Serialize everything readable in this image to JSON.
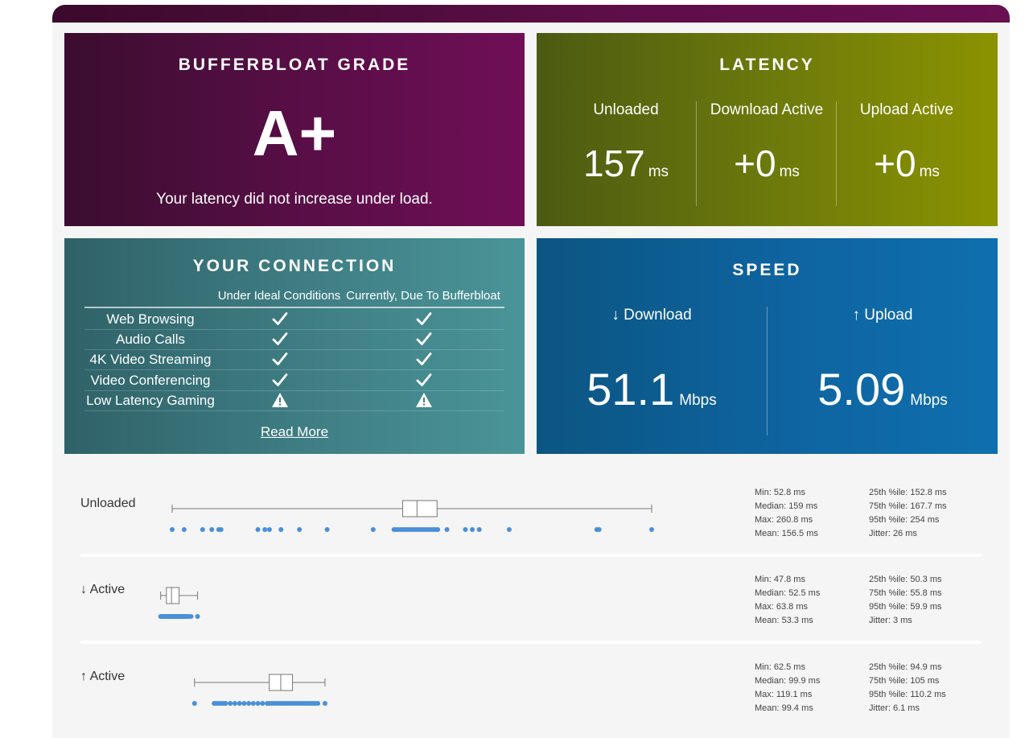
{
  "grade": {
    "title": "BUFFERBLOAT GRADE",
    "letter": "A+",
    "message": "Your latency did not increase under load."
  },
  "latency": {
    "title": "LATENCY",
    "columns": [
      {
        "label": "Unloaded",
        "value": "157",
        "unit": "ms"
      },
      {
        "label": "Download Active",
        "value": "+0",
        "unit": "ms"
      },
      {
        "label": "Upload Active",
        "value": "+0",
        "unit": "ms"
      }
    ]
  },
  "connection": {
    "title": "YOUR CONNECTION",
    "col_ideal": "Under Ideal Conditions",
    "col_current": "Currently, Due To Bufferbloat",
    "rows": [
      {
        "name": "Web Browsing",
        "ideal": "check",
        "current": "check"
      },
      {
        "name": "Audio Calls",
        "ideal": "check",
        "current": "check"
      },
      {
        "name": "4K Video Streaming",
        "ideal": "check",
        "current": "check"
      },
      {
        "name": "Video Conferencing",
        "ideal": "check",
        "current": "check"
      },
      {
        "name": "Low Latency Gaming",
        "ideal": "warning",
        "current": "warning"
      }
    ],
    "read_more": "Read More"
  },
  "speed": {
    "title": "SPEED",
    "download": {
      "label": "↓ Download",
      "value": "51.1",
      "unit": "Mbps"
    },
    "upload": {
      "label": "↑ Upload",
      "value": "5.09",
      "unit": "Mbps"
    }
  },
  "stats": [
    {
      "label": "Unloaded",
      "left": [
        "Min: 52.8 ms",
        "Median: 159 ms",
        "Max: 260.8 ms",
        "Mean: 156.5 ms"
      ],
      "right": [
        "25th %ile: 152.8 ms",
        "75th %ile: 167.7 ms",
        "95th %ile: 254 ms",
        "Jitter: 26 ms"
      ],
      "box": {
        "min": 52.8,
        "q1": 152.8,
        "median": 159,
        "q3": 167.7,
        "max": 260.8
      },
      "points": [
        52.8,
        58,
        66,
        70,
        73,
        74,
        90,
        93,
        95,
        100,
        108,
        120,
        140,
        149,
        150,
        151,
        152,
        153,
        154,
        155,
        156,
        157,
        158,
        159,
        160,
        161,
        162,
        163,
        164,
        165,
        166,
        167,
        168,
        172,
        180,
        183,
        186,
        199,
        237,
        238,
        260.8
      ]
    },
    {
      "label": "↓ Active",
      "left": [
        "Min: 47.8 ms",
        "Median: 52.5 ms",
        "Max: 63.8 ms",
        "Mean: 53.3 ms"
      ],
      "right": [
        "25th %ile: 50.3 ms",
        "75th %ile: 55.8 ms",
        "95th %ile: 59.9 ms",
        "Jitter: 3 ms"
      ],
      "box": {
        "min": 47.8,
        "q1": 50.3,
        "median": 52.5,
        "q3": 55.8,
        "max": 63.8
      },
      "points": [
        47.8,
        48.5,
        49,
        49.5,
        50,
        50.5,
        51,
        51.5,
        52,
        52.5,
        53,
        53.5,
        54,
        54.5,
        55,
        55.5,
        56,
        56.5,
        57,
        57.5,
        58,
        58.5,
        59,
        59.5,
        60,
        61,
        63.8
      ]
    },
    {
      "label": "↑ Active",
      "left": [
        "Min: 62.5 ms",
        "Median: 99.9 ms",
        "Max: 119.1 ms",
        "Mean: 99.4 ms"
      ],
      "right": [
        "25th %ile: 94.9 ms",
        "75th %ile: 105 ms",
        "95th %ile: 110.2 ms",
        "Jitter: 6.1 ms"
      ],
      "box": {
        "min": 62.5,
        "q1": 94.9,
        "median": 99.9,
        "q3": 105,
        "max": 119.1
      },
      "points": [
        62.5,
        71,
        72,
        73,
        74,
        75,
        76,
        78,
        80,
        82,
        84,
        86,
        88,
        90,
        92,
        94,
        95,
        96,
        97,
        98,
        99,
        100,
        101,
        102,
        103,
        104,
        105,
        106,
        107,
        108,
        109,
        110,
        111,
        112,
        113,
        114,
        115,
        116,
        119.1
      ]
    }
  ]
}
